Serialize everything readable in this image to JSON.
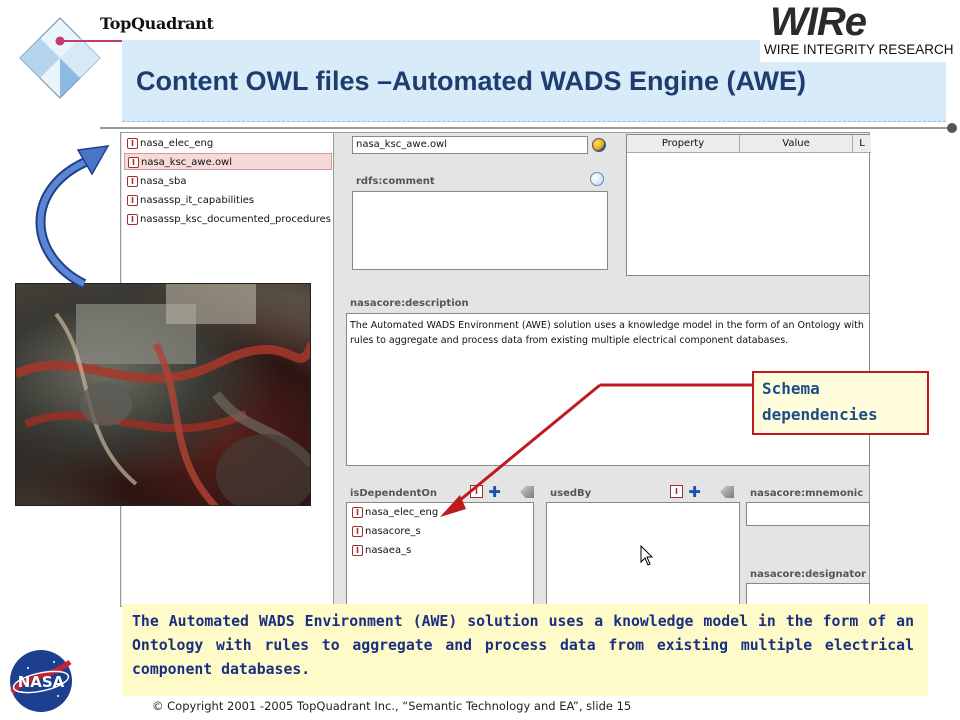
{
  "header": {
    "company_logo_text": "TopQuadrant",
    "slide_title": "Content OWL files –Automated WADS Engine (AWE)",
    "partner_logo": {
      "big": "WIRe",
      "sub": "WIRE INTEGRITY RESEARCH"
    }
  },
  "ontology_list": {
    "items": [
      {
        "label": "nasa_elec_eng",
        "selected": false
      },
      {
        "label": "nasa_ksc_awe.owl",
        "selected": true
      },
      {
        "label": "nasa_sba",
        "selected": false
      },
      {
        "label": "nasassp_it_capabilities",
        "selected": false
      },
      {
        "label": "nasassp_ksc_documented_procedures",
        "selected": false
      }
    ],
    "item_icon": "I"
  },
  "form": {
    "name_value": "nasa_ksc_awe.owl",
    "rdfs_comment_label": "rdfs:comment",
    "property_table": {
      "headers": [
        "Property",
        "Value",
        "L"
      ]
    },
    "description_label": "nasacore:description",
    "description_lines": [
      "The Automated WADS Environment (AWE) solution uses a knowledge model in the form of an Ontology with",
      "rules to aggregate and process data from existing multiple electrical component databases."
    ],
    "is_dependent_on_label": "isDependentOn",
    "is_dependent_on_items": [
      "nasa_elec_eng",
      "nasacore_s",
      "nasaea_s"
    ],
    "used_by_label": "usedBy",
    "mnemonic_label": "nasacore:mnemonic",
    "designator_label": "nasacore:designator"
  },
  "callout": {
    "line1": "Schema",
    "line2": "dependencies",
    "border_color": "#c0191f"
  },
  "caption": {
    "text": "The Automated WADS Environment (AWE) solution uses a knowledge model in the form of an Ontology with rules to aggregate and process data from existing multiple electrical component databases."
  },
  "footer": {
    "text": "© Copyright 2001 -2005 TopQuadrant Inc., “Semantic Technology and EA”, slide 15"
  },
  "icons": [
    "topquadrant-diamond-icon",
    "globe-icon",
    "comment-icon",
    "instance-icon",
    "add-icon",
    "delete-icon",
    "mouse-cursor-icon",
    "nasa-logo"
  ],
  "colors": {
    "title": "#1f3c6e",
    "title_band": "#d7ecf8",
    "caption_bg": "#fffbc8",
    "caption_text": "#1a2f82",
    "arrow_red": "#c0191f",
    "curved_arrow_blue": "#3a63b8"
  }
}
